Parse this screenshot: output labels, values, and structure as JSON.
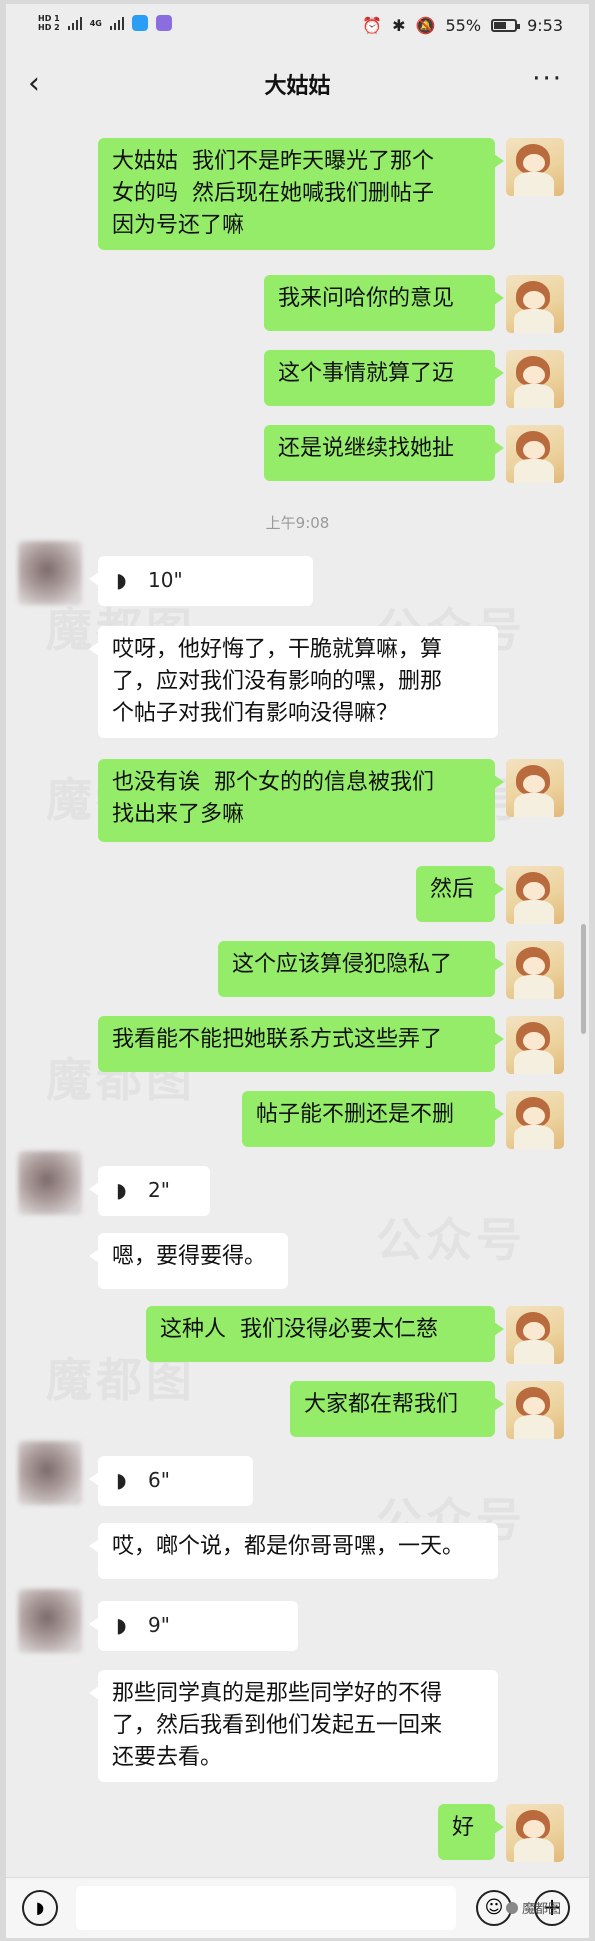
{
  "status_bar": {
    "hd1": "HD 1",
    "hd2": "HD 2",
    "net1": "4G",
    "net2": "4G",
    "battery": "55%",
    "battery_level": 0.55,
    "time": "9:53"
  },
  "header": {
    "back_icon": "chevron-left-icon",
    "title": "大姑姑",
    "more_icon": "more-dots-icon",
    "more_label": "···"
  },
  "messages": [
    {
      "from": "me",
      "text": "大姑姑  我们不是昨天曝光了那个\n女的吗  然后现在她喊我们删帖子\n因为号还了嘛"
    },
    {
      "from": "me",
      "text": "我来问哈你的意见"
    },
    {
      "from": "me",
      "text": "这个事情就算了迈"
    },
    {
      "from": "me",
      "text": "还是说继续找她扯"
    },
    {
      "timestamp": "上午9:08"
    },
    {
      "from": "other",
      "voice": "10\""
    },
    {
      "from": "other",
      "text": "哎呀，他好悔了，干脆就算嘛，算\n了，应对我们没有影响的嘿，删那\n个帖子对我们有影响没得嘛？"
    },
    {
      "from": "me",
      "text": "也没有诶  那个女的的信息被我们\n找出来了多嘛"
    },
    {
      "from": "me",
      "text": "然后"
    },
    {
      "from": "me",
      "text": "这个应该算侵犯隐私了"
    },
    {
      "from": "me",
      "text": "我看能不能把她联系方式这些弄了"
    },
    {
      "from": "me",
      "text": "帖子能不删还是不删"
    },
    {
      "from": "other",
      "voice": "2\""
    },
    {
      "from": "other",
      "text": "嗯，要得要得。"
    },
    {
      "from": "me",
      "text": "这种人  我们没得必要太仁慈"
    },
    {
      "from": "me",
      "text": "大家都在帮我们"
    },
    {
      "from": "other",
      "voice": "6\""
    },
    {
      "from": "other",
      "text": "哎，啷个说，都是你哥哥嘿，一天。"
    },
    {
      "from": "other",
      "voice": "9\""
    },
    {
      "from": "other",
      "text": "那些同学真的是那些同学好的不得\n了，然后我看到他们发起五一回来\n还要去看。"
    },
    {
      "from": "me",
      "text": "好"
    }
  ],
  "watermarks": [
    "魔都图",
    "公众号"
  ],
  "input_bar": {
    "voice_icon": "voice-wave-icon",
    "emoji_icon": "emoji-icon",
    "plus_icon": "plus-icon",
    "credit": "魔都图"
  },
  "colors": {
    "me_bubble": "#95ec69",
    "other_bubble": "#ffffff",
    "background": "#ededed"
  }
}
